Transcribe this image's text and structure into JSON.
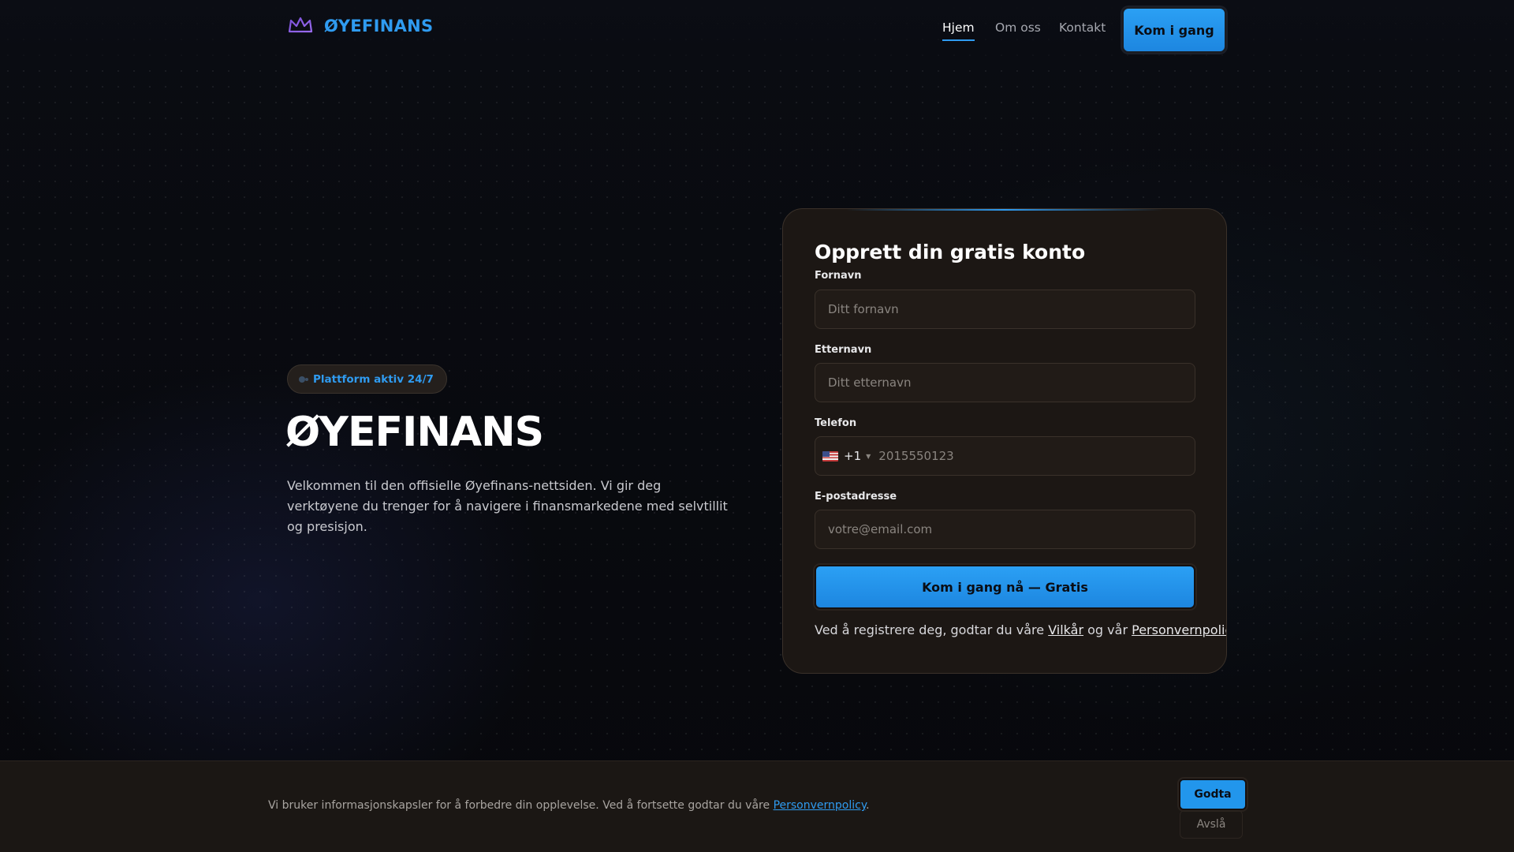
{
  "brand": {
    "name": "ØYEFINANS",
    "accent_color": "#2f9bf0",
    "logo_icon": "crown-icon"
  },
  "nav": {
    "items": [
      {
        "label": "Hjem",
        "active": true
      },
      {
        "label": "Om oss",
        "active": false
      },
      {
        "label": "Kontakt",
        "active": false
      }
    ],
    "cta_label": "Kom i gang"
  },
  "hero": {
    "badge": "Plattform aktiv 24/7",
    "title": "ØYEFINANS",
    "description": "Velkommen til den offisielle Øyefinans-nettsiden. Vi gir deg verktøyene du trenger for å navigere i finansmarkedene med selvtillit og presisjon."
  },
  "form": {
    "title": "Opprett din gratis konto",
    "first_name": {
      "label": "Fornavn",
      "placeholder": "Ditt fornavn"
    },
    "last_name": {
      "label": "Etternavn",
      "placeholder": "Ditt etternavn"
    },
    "phone": {
      "label": "Telefon",
      "country_flag": "us-flag-icon",
      "dial_code": "+1",
      "placeholder": "2015550123"
    },
    "email": {
      "label": "E-postadresse",
      "placeholder": "votre@email.com"
    },
    "submit_label": "Kom i gang nå — Gratis",
    "terms_prefix": "Ved å registrere deg, godtar du våre",
    "terms_link": "Vilkår",
    "terms_mid": "og vår",
    "privacy_link": "Personvernpolicy",
    "terms_suffix": "."
  },
  "cookie": {
    "text": "Vi bruker informasjonskapsler for å forbedre din opplevelse. Ved å fortsette godtar du våre",
    "link": "Personvernpolicy",
    "suffix": ".",
    "accept_label": "Godta",
    "decline_label": "Avslå"
  }
}
